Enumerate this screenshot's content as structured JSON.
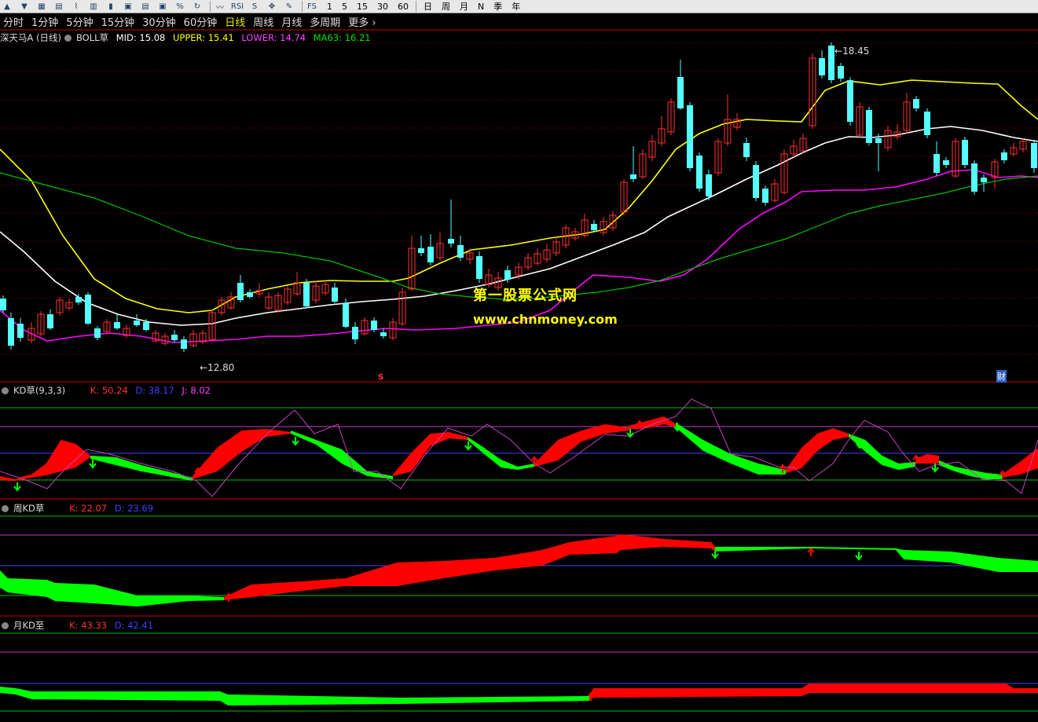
{
  "toolbar": {
    "icons": [
      "up-arrow-icon",
      "down-arrow-icon",
      "grid-icon",
      "table-icon",
      "line-chart-icon",
      "candle-icon",
      "bar-chart-icon",
      "f10-icon",
      "report-icon",
      "f12-icon",
      "pct-icon",
      "refresh-icon",
      "trend-icon",
      "rsi-icon",
      "settings-icon",
      "move-icon",
      "pencil-icon",
      "formula-icon"
    ],
    "rsi_label": "RSI",
    "fs_label": "FS",
    "periods_short": [
      "1",
      "5",
      "15",
      "30",
      "60",
      "日",
      "周",
      "月",
      "N",
      "季",
      "年"
    ]
  },
  "periods": [
    {
      "label": "分时",
      "active": false
    },
    {
      "label": "1分钟",
      "active": false
    },
    {
      "label": "5分钟",
      "active": false
    },
    {
      "label": "15分钟",
      "active": false
    },
    {
      "label": "30分钟",
      "active": false
    },
    {
      "label": "60分钟",
      "active": false
    },
    {
      "label": "日线",
      "active": true
    },
    {
      "label": "周线",
      "active": false
    },
    {
      "label": "月线",
      "active": false
    },
    {
      "label": "多周期",
      "active": false
    },
    {
      "label": "更多",
      "active": false
    }
  ],
  "main": {
    "stock": "深天马A (日线)",
    "indicator": "BOLL草",
    "mid": "MID: 15.08",
    "upper": "UPPER: 15.41",
    "lower": "LOWER: 14.74",
    "ma63": "MA63: 16.21",
    "high_label": "18.45",
    "low_label": "12.80",
    "marker_s": "s",
    "marker_cai": "财",
    "watermark_title": "第一股票公式网",
    "watermark_url": "www.chnmoney.com"
  },
  "kd_panel": {
    "name": "KD草(9,3,3)",
    "k": "K: 50.24",
    "d": "D: 38.17",
    "j": "J: 8.02"
  },
  "week_panel": {
    "name": "周KD草",
    "k": "K: 22.07",
    "d": "D: 23.69"
  },
  "month_panel": {
    "name": "月KD至",
    "k": "K: 43.33",
    "d": "D: 42.41"
  },
  "colors": {
    "upper": "#ffff00",
    "mid": "#ffffff",
    "lower": "#ff00ff",
    "ma63": "#00c000",
    "up_candle": "#ff3030",
    "down_candle": "#54ffff",
    "kd_red": "#ff0000",
    "kd_green": "#00ff00",
    "grid_red": "#8a0000",
    "active_period": "#e6e600"
  }
}
